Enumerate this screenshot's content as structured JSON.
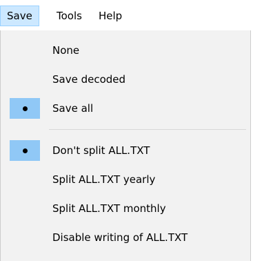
{
  "menubar": {
    "items": [
      {
        "label": "Save"
      },
      {
        "label": "Tools"
      },
      {
        "label": "Help"
      }
    ]
  },
  "save_menu": {
    "group1": [
      {
        "label": "None",
        "checked": false
      },
      {
        "label": "Save decoded",
        "checked": false
      },
      {
        "label": "Save all",
        "checked": true
      }
    ],
    "group2": [
      {
        "label": "Don't split ALL.TXT",
        "checked": true
      },
      {
        "label": "Split ALL.TXT yearly",
        "checked": false
      },
      {
        "label": "Split ALL.TXT monthly",
        "checked": false
      },
      {
        "label": "Disable writing of ALL.TXT",
        "checked": false
      }
    ]
  },
  "colors": {
    "menu_background": "#f2f2f2",
    "active_menubar": "#cce8ff",
    "radio_highlight": "#90c8f6"
  }
}
